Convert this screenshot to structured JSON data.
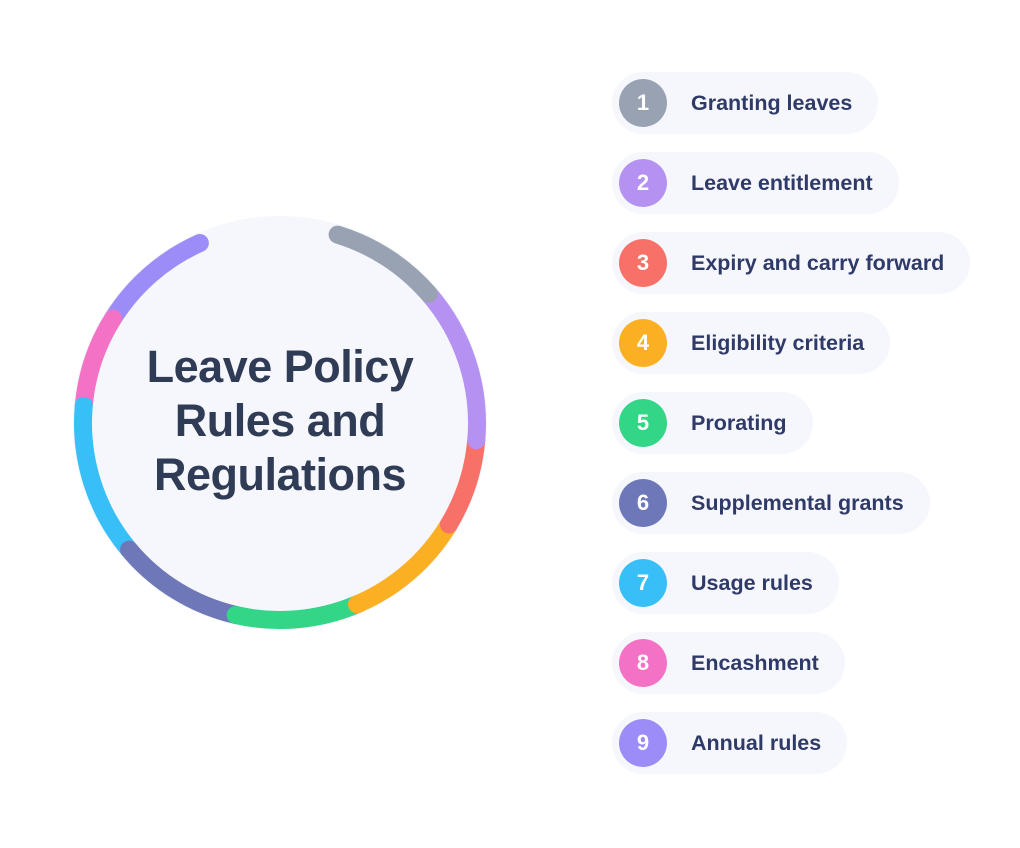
{
  "center": {
    "lines": [
      "Leave Policy",
      "Rules and",
      "Regulations"
    ]
  },
  "items": [
    {
      "number": "1",
      "label": "Granting leaves",
      "color": "#98a2b3"
    },
    {
      "number": "2",
      "label": "Leave entitlement",
      "color": "#b592f2"
    },
    {
      "number": "3",
      "label": "Expiry and carry forward",
      "color": "#f87168"
    },
    {
      "number": "4",
      "label": "Eligibility criteria",
      "color": "#fbb024"
    },
    {
      "number": "5",
      "label": "Prorating",
      "color": "#33d587"
    },
    {
      "number": "6",
      "label": "Supplemental grants",
      "color": "#6e78b8"
    },
    {
      "number": "7",
      "label": "Usage rules",
      "color": "#38bff8"
    },
    {
      "number": "8",
      "label": "Encashment",
      "color": "#f472c5"
    },
    {
      "number": "9",
      "label": "Annual rules",
      "color": "#9c8cf8"
    }
  ]
}
